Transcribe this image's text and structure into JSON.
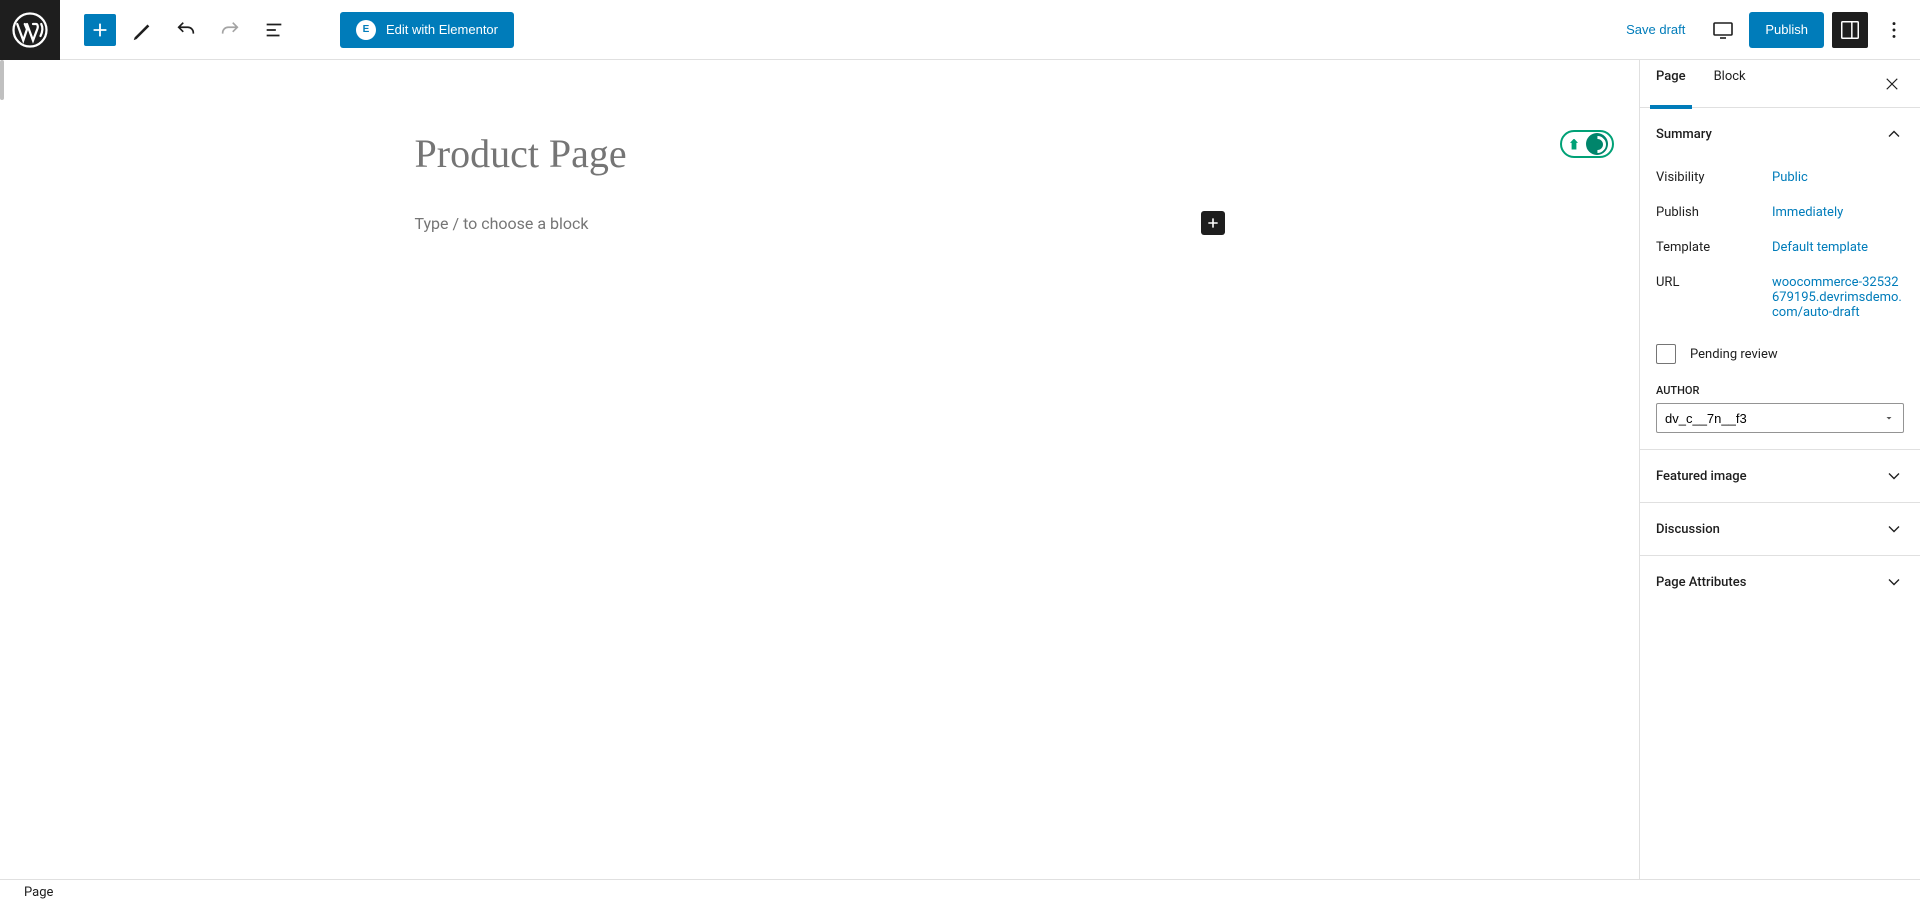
{
  "toolbar": {
    "elementor_label": "Edit with Elementor",
    "save_draft": "Save draft",
    "publish": "Publish"
  },
  "editor": {
    "title": "Product Page",
    "block_placeholder": "Type / to choose a block"
  },
  "sidebar": {
    "tabs": {
      "page": "Page",
      "block": "Block"
    },
    "summary": {
      "title": "Summary",
      "visibility": {
        "label": "Visibility",
        "value": "Public"
      },
      "publish": {
        "label": "Publish",
        "value": "Immediately"
      },
      "template": {
        "label": "Template",
        "value": "Default template"
      },
      "url": {
        "label": "URL",
        "value": "woocommerce-32532679195.devrimsdemo.com/auto-draft"
      },
      "pending_review": "Pending review",
      "author_label": "AUTHOR",
      "author_value": "dv_c__7n__f3"
    },
    "panels": {
      "featured_image": "Featured image",
      "discussion": "Discussion",
      "page_attributes": "Page Attributes"
    }
  },
  "bottom": {
    "breadcrumb": "Page"
  }
}
